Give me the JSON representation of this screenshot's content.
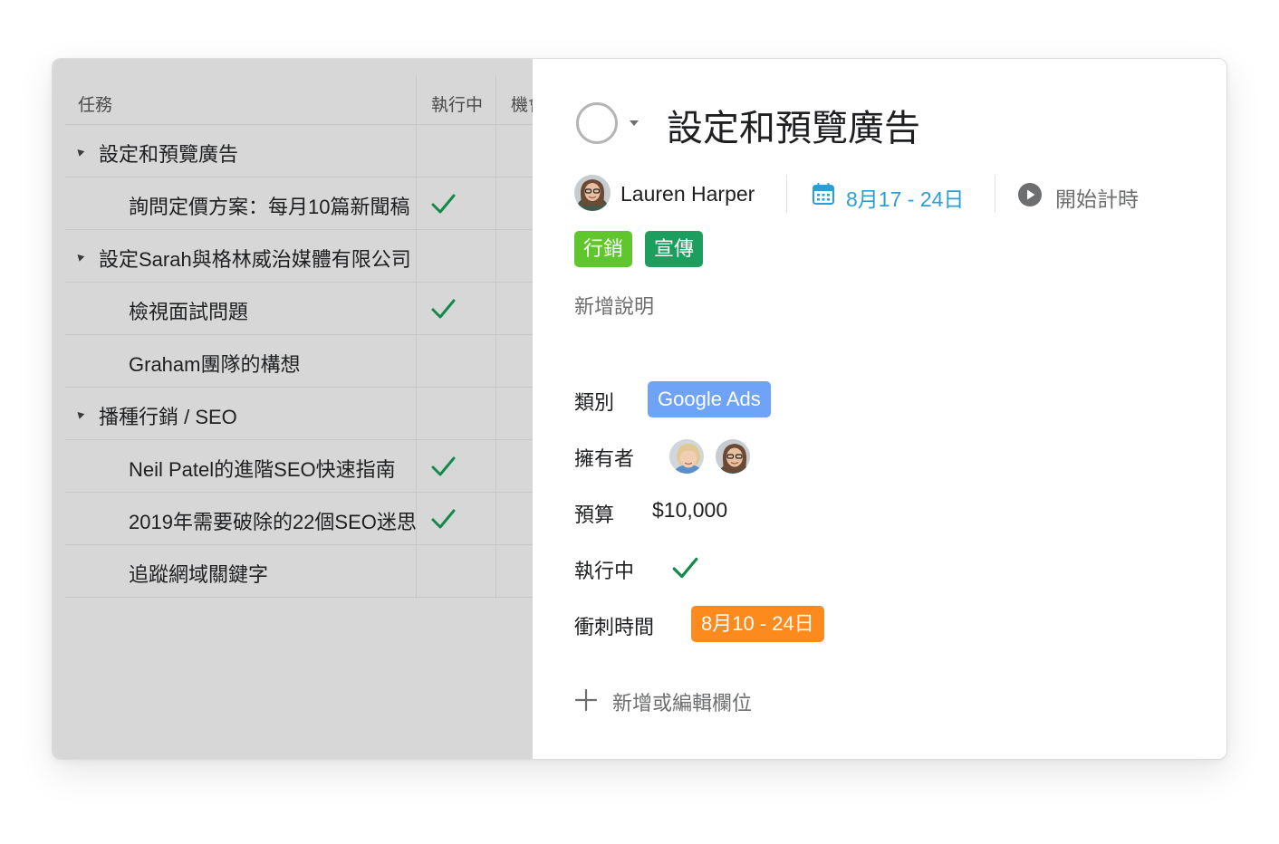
{
  "table": {
    "headers": {
      "task": "任務",
      "active": "執行中",
      "third": "機會"
    },
    "rows": [
      {
        "name": "設定和預覽廣告",
        "section": true,
        "checked": false
      },
      {
        "name": "詢問定價方案：每月10篇新聞稿",
        "section": false,
        "checked": true
      },
      {
        "name": "設定Sarah與格林威治媒體有限公司",
        "section": true,
        "checked": false
      },
      {
        "name": "檢視面試問題",
        "section": false,
        "checked": true
      },
      {
        "name": "Graham團隊的構想",
        "section": false,
        "checked": false
      },
      {
        "name": "播種行銷 / SEO",
        "section": true,
        "checked": false
      },
      {
        "name": "Neil Patel的進階SEO快速指南",
        "section": false,
        "checked": true
      },
      {
        "name": "2019年需要破除的22個SEO迷思",
        "section": false,
        "checked": true
      },
      {
        "name": "追蹤網域關鍵字",
        "section": false,
        "checked": false
      }
    ]
  },
  "detail": {
    "title": "設定和預覽廣告",
    "assignee": "Lauren Harper",
    "due_date": "8月17 - 24日",
    "timer_label": "開始計時",
    "tags": [
      {
        "label": "行銷",
        "color": "#5fc72d"
      },
      {
        "label": "宣傳",
        "color": "#1e9e5c"
      }
    ],
    "description_placeholder": "新增說明",
    "fields": {
      "category_label": "類別",
      "category_value": "Google Ads",
      "category_color": "#6fa3f7",
      "owners_label": "擁有者",
      "budget_label": "預算",
      "budget_value": "$10,000",
      "active_label": "執行中",
      "sprint_label": "衝刺時間",
      "sprint_value": "8月10 - 24日",
      "sprint_color": "#fd8a1d"
    },
    "add_field_label": "新增或編輯欄位"
  },
  "icons": {
    "complete": "circle-check-icon",
    "calendar": "calendar-icon",
    "play": "play-icon",
    "plus": "plus-icon",
    "check": "checkmark-icon"
  },
  "colors": {
    "check_green": "#138a4a",
    "due_blue": "#2c9ed4",
    "overlay_gray": "#d7d7d7"
  }
}
